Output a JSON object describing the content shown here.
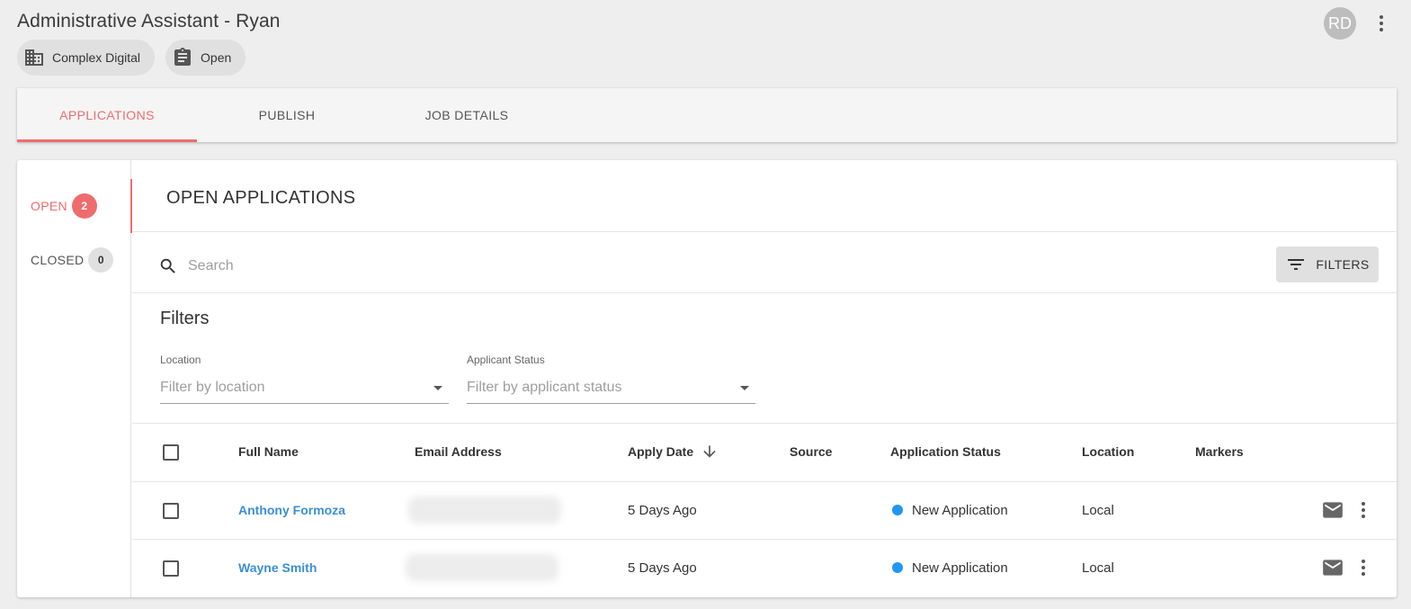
{
  "page": {
    "title": "Administrative Assistant - Ryan",
    "company_chip": "Complex Digital",
    "status_chip": "Open",
    "avatar_initials": "RD"
  },
  "tabs": [
    "APPLICATIONS",
    "PUBLISH",
    "JOB DETAILS"
  ],
  "sidebar": {
    "open_label": "OPEN",
    "open_count": "2",
    "closed_label": "CLOSED",
    "closed_count": "0"
  },
  "main": {
    "section_title": "OPEN APPLICATIONS",
    "search_placeholder": "Search",
    "filters_button": "FILTERS",
    "filters_title": "Filters",
    "location_label": "Location",
    "location_placeholder": "Filter by location",
    "status_label": "Applicant Status",
    "status_placeholder": "Filter by applicant status"
  },
  "table": {
    "columns": [
      "Full Name",
      "Email Address",
      "Apply Date",
      "Source",
      "Application Status",
      "Location",
      "Markers"
    ],
    "rows": [
      {
        "name": "Anthony Formoza",
        "apply_date": "5 Days Ago",
        "source": "",
        "status": "New Application",
        "location": "Local",
        "markers": ""
      },
      {
        "name": "Wayne Smith",
        "apply_date": "5 Days Ago",
        "source": "",
        "status": "New Application",
        "location": "Local",
        "markers": ""
      }
    ]
  },
  "colors": {
    "accent": "#ef6c6c",
    "link": "#3a8fd6",
    "status_new": "#2196f3"
  }
}
